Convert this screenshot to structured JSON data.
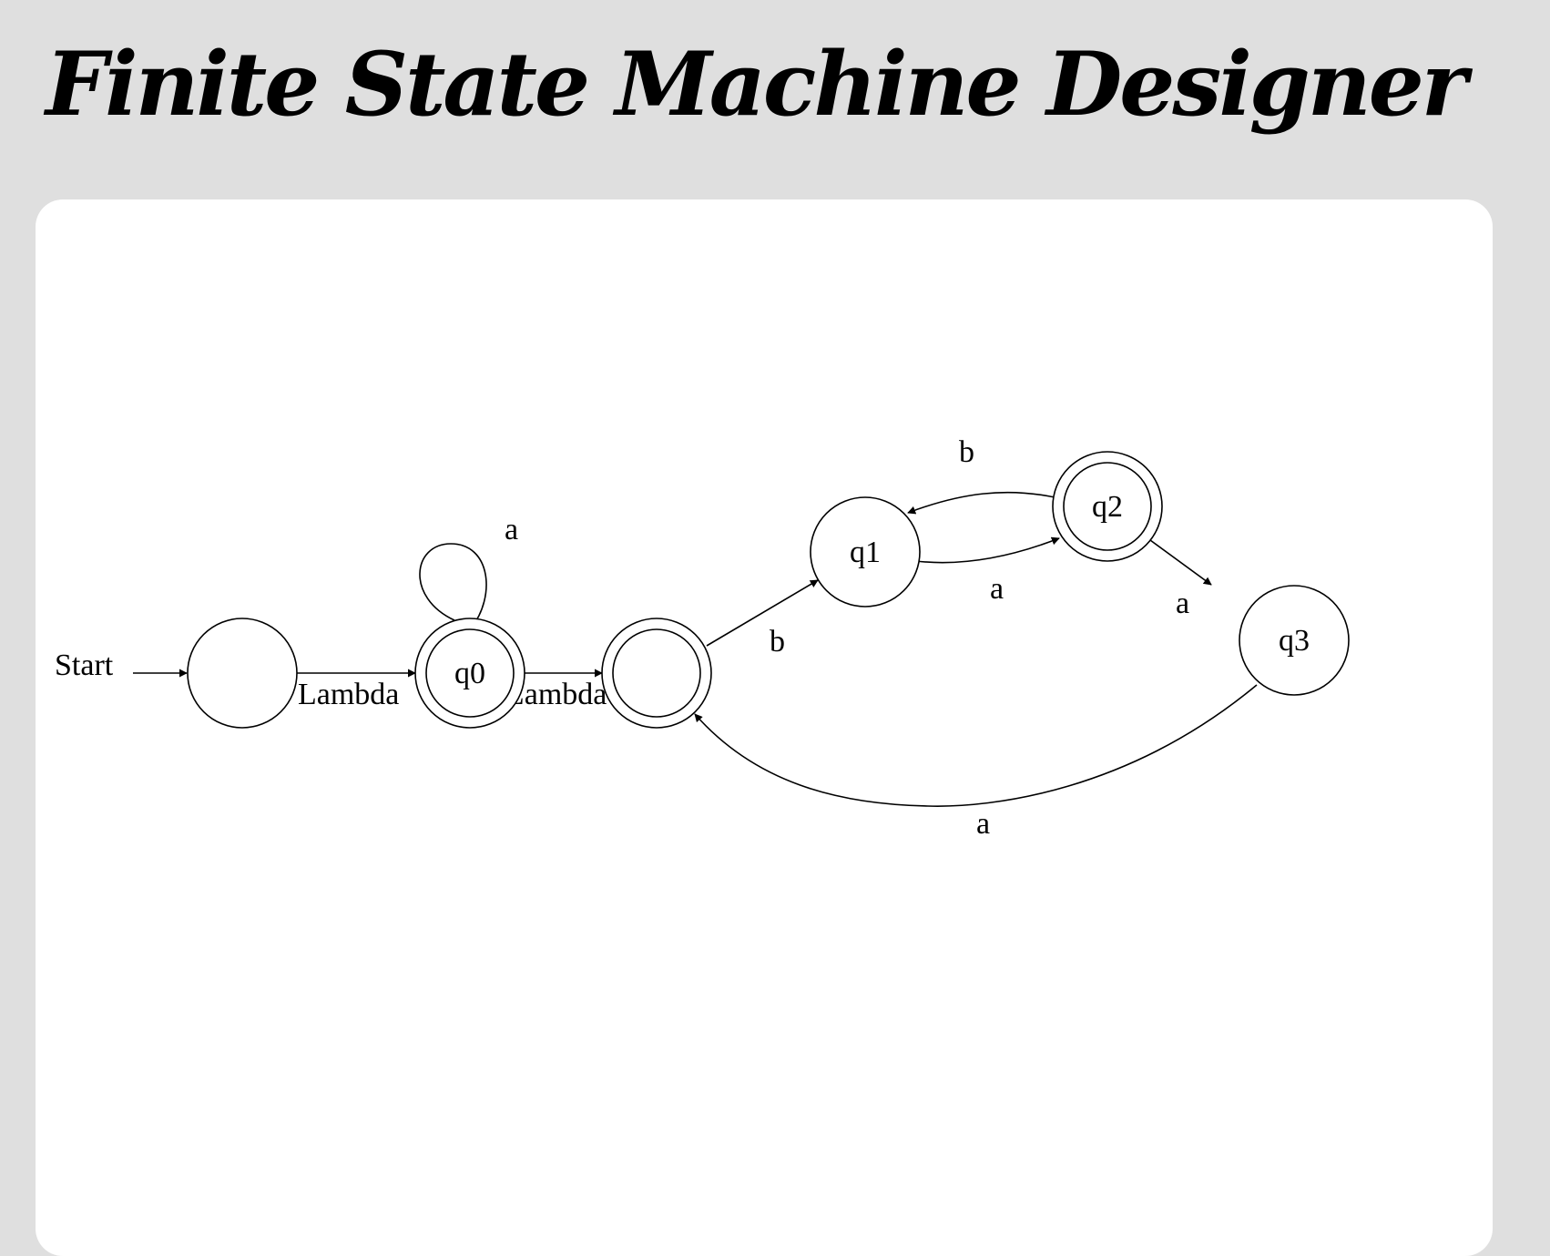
{
  "header": {
    "title": "Finite State Machine Designer"
  },
  "canvas": {
    "background": "#ffffff",
    "page_background": "#dfdfdf",
    "start_label": "Start",
    "states": [
      {
        "id": "s0",
        "label": "",
        "accepting": false
      },
      {
        "id": "q0",
        "label": "q0",
        "accepting": true
      },
      {
        "id": "s2",
        "label": "",
        "accepting": true
      },
      {
        "id": "q1",
        "label": "q1",
        "accepting": false
      },
      {
        "id": "q2",
        "label": "q2",
        "accepting": true
      },
      {
        "id": "q3",
        "label": "q3",
        "accepting": false
      }
    ],
    "transitions": [
      {
        "from": "s0",
        "to": "q0",
        "symbol": "Lambda"
      },
      {
        "from": "q0",
        "to": "q0",
        "symbol": "a"
      },
      {
        "from": "q0",
        "to": "s2",
        "symbol": "Lambda"
      },
      {
        "from": "s2",
        "to": "q1",
        "symbol": "b"
      },
      {
        "from": "q1",
        "to": "q2",
        "symbol": "a"
      },
      {
        "from": "q2",
        "to": "q1",
        "symbol": "b"
      },
      {
        "from": "q2",
        "to": "q3",
        "symbol": "a"
      },
      {
        "from": "q3",
        "to": "s2",
        "symbol": "a"
      }
    ]
  }
}
